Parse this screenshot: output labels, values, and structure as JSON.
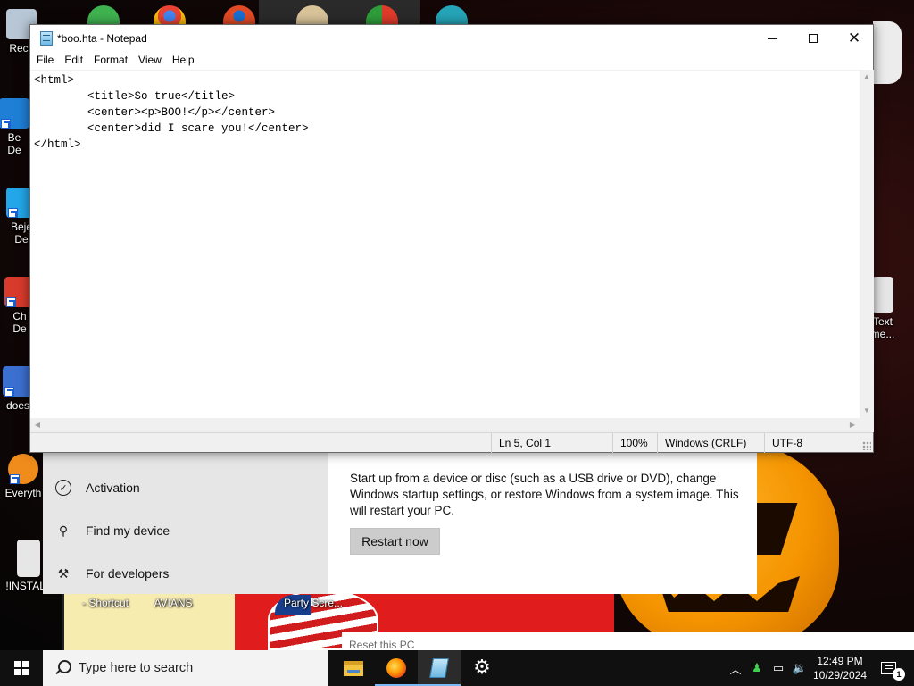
{
  "desktop": {
    "icons_left": [
      {
        "label": "Recy",
        "color": "#b8c7d6"
      },
      {
        "label": "Be",
        "label2": "De",
        "color": "#1f7fd6"
      },
      {
        "label": "Beje",
        "label2": "De",
        "color": "#23a7e8"
      },
      {
        "label": "Ch",
        "label2": "De",
        "color": "#d83a2c"
      },
      {
        "label": "does",
        "color": "#3b6fd0"
      },
      {
        "label": "Everyth",
        "color": "#f08c1c"
      },
      {
        "label": "!INSTALL",
        "color": "#e6e6e6"
      }
    ],
    "icons_bottom": [
      "- Shortcut",
      "AVIANS",
      "Party Scre..."
    ],
    "icon_right": {
      "label": "Text",
      "label2": "me...",
      "color": "#e6e6e6"
    }
  },
  "settings": {
    "nav_items": [
      {
        "label": "Activation",
        "icon": "check-circle-icon"
      },
      {
        "label": "Find my device",
        "icon": "person-pin-icon"
      },
      {
        "label": "For developers",
        "icon": "tools-icon"
      }
    ],
    "description": "Start up from a device or disc (such as a USB drive or DVD), change Windows startup settings, or restore Windows from a system image. This will restart your PC.",
    "restart_button": "Restart now",
    "reset_bar": "Reset this PC"
  },
  "notepad": {
    "title": "*boo.hta - Notepad",
    "menu": [
      "File",
      "Edit",
      "Format",
      "View",
      "Help"
    ],
    "content": "<html>\n        <title>So true</title>\n        <center><p>BOO!</p></center>\n        <center>did I scare you!</center>\n</html>",
    "status": {
      "position": "Ln 5, Col 1",
      "zoom": "100%",
      "line_ending": "Windows (CRLF)",
      "encoding": "UTF-8"
    }
  },
  "taskbar": {
    "search_placeholder": "Type here to search",
    "apps": [
      "file-explorer-icon",
      "firefox-icon",
      "notepad-icon",
      "settings-gear-icon"
    ],
    "clock_time": "12:49 PM",
    "clock_date": "10/29/2024",
    "notification_count": "1",
    "tray_icons": [
      "chevron-up-icon",
      "people-icon",
      "network-icon",
      "volume-icon"
    ]
  }
}
